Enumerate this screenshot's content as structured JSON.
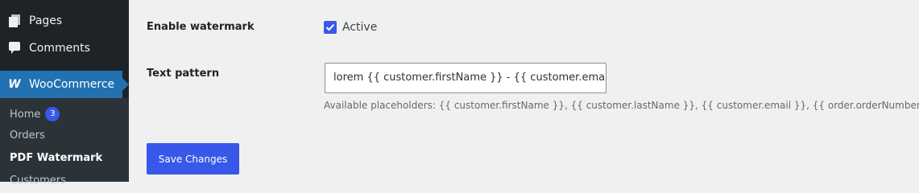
{
  "sidebar": {
    "pages_label": "Pages",
    "pages_icon": "pages-icon",
    "comments_label": "Comments",
    "comments_icon": "comment-icon",
    "woocommerce_label": "WooCommerce",
    "woocommerce_icon": "woocommerce-logo",
    "woocommerce_logo_glyph": "W",
    "submenu": {
      "home_label": "Home",
      "home_badge": "3",
      "orders_label": "Orders",
      "pdf_watermark_label": "PDF Watermark",
      "customers_label": "Customers"
    }
  },
  "form": {
    "enable_watermark_label": "Enable watermark",
    "active_label": "Active",
    "active_checked": true,
    "text_pattern_label": "Text pattern",
    "text_pattern_value": "lorem {{ customer.firstName }} - {{ customer.email }},",
    "placeholders_hint": "Available placeholders: {{ customer.firstName }}, {{ customer.lastName }}, {{ customer.email }}, {{ order.orderNumber }}",
    "save_label": "Save Changes"
  },
  "colors": {
    "sidebar_bg": "#1d2327",
    "active_menu": "#2271b1",
    "accent": "#3858e9",
    "page_bg": "#f0f0f1"
  }
}
